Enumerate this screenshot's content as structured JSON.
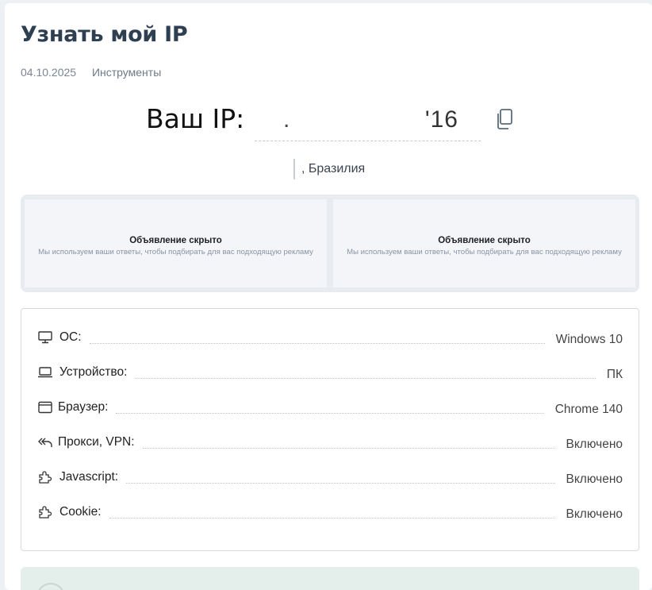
{
  "page": {
    "title": "Узнать мой IP",
    "date": "04.10.2025",
    "category": "Инструменты"
  },
  "ip": {
    "label": "Ваш IP:",
    "value_visible_start": ".",
    "value_visible_end": "'16",
    "copy_icon": "copy-icon"
  },
  "location": {
    "text": ", Бразилия"
  },
  "ads": [
    {
      "title": "Объявление скрыто",
      "description": "Мы используем ваши ответы, чтобы подбирать для вас подходящую рекламу"
    },
    {
      "title": "Объявление скрыто",
      "description": "Мы используем ваши ответы, чтобы подбирать для вас подходящую рекламу"
    }
  ],
  "info_rows": [
    {
      "icon": "monitor-icon",
      "label": "ОС:",
      "value": "Windows 10"
    },
    {
      "icon": "laptop-icon",
      "label": "Устройство:",
      "value": "ПК"
    },
    {
      "icon": "browser-window-icon",
      "label": "Браузер:",
      "value": "Chrome 140"
    },
    {
      "icon": "reply-arrows-icon",
      "label": "Прокси, VPN:",
      "value": "Включено"
    },
    {
      "icon": "puzzle-icon",
      "label": "Javascript:",
      "value": "Включено"
    },
    {
      "icon": "puzzle-icon",
      "label": "Cookie:",
      "value": "Включено"
    }
  ],
  "colors": {
    "title": "#2f3f52",
    "accent_box": "#e4eeeb"
  }
}
